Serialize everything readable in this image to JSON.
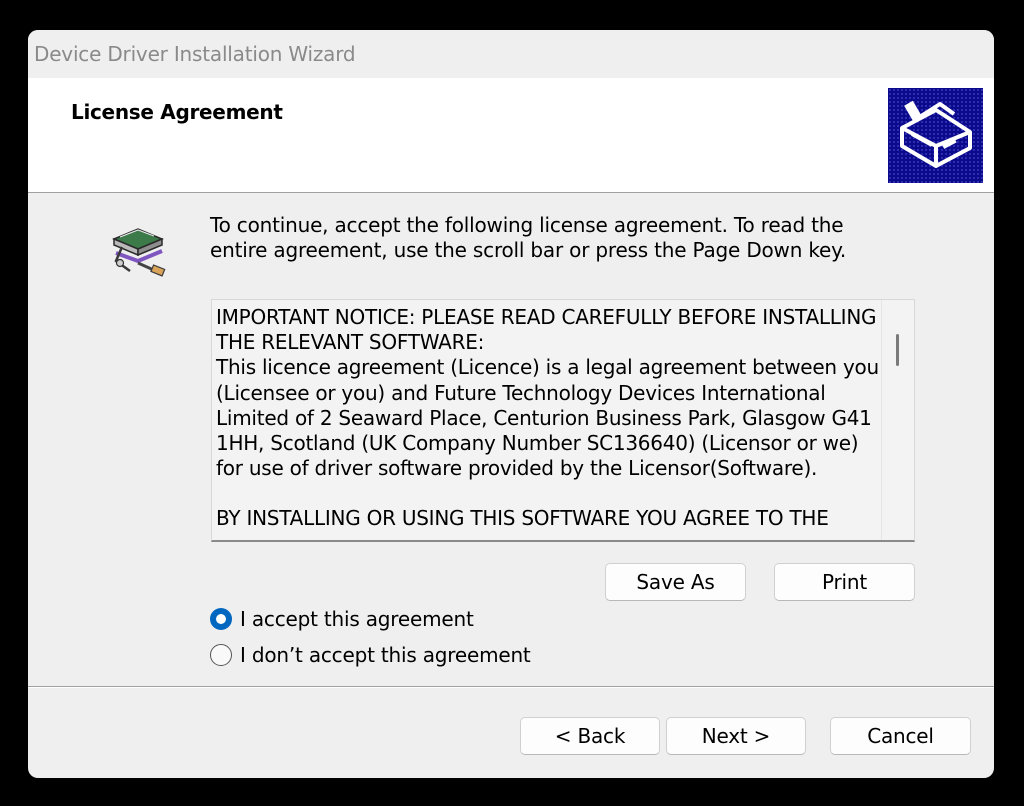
{
  "window": {
    "title": "Device Driver Installation Wizard"
  },
  "header": {
    "heading": "License Agreement",
    "logo_icon": "hardware-install-icon"
  },
  "content": {
    "icon": "software-install-icon",
    "instructions": "To continue, accept the following license agreement. To read the entire agreement, use the scroll bar or press the Page Down key.",
    "license": {
      "paragraphs": [
        "IMPORTANT NOTICE: PLEASE READ CAREFULLY BEFORE INSTALLING THE RELEVANT SOFTWARE:",
        "This licence agreement (Licence) is a legal agreement between you (Licensee or you) and Future Technology Devices International Limited of 2 Seaward Place, Centurion Business Park, Glasgow G41 1HH, Scotland (UK Company Number SC136640) (Licensor or we) for use of driver software provided by the Licensor(Software).",
        "BY INSTALLING OR USING THIS SOFTWARE YOU AGREE TO THE"
      ]
    },
    "options": {
      "accept_label": "I accept this agreement",
      "decline_label": "I don’t accept this agreement",
      "selected": "accept"
    },
    "save_as_label": "Save As",
    "print_label": "Print"
  },
  "footer": {
    "back_label": "< Back",
    "next_label": "Next >",
    "cancel_label": "Cancel"
  },
  "colors": {
    "accent": "#0067c0",
    "logo_background": "#0a0a8a"
  }
}
